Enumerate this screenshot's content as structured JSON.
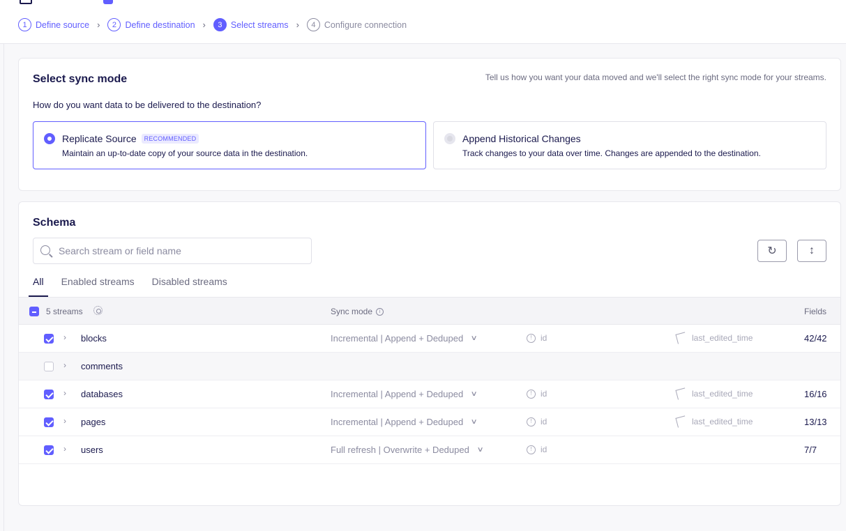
{
  "steps": [
    {
      "num": "1",
      "label": "Define source"
    },
    {
      "num": "2",
      "label": "Define destination"
    },
    {
      "num": "3",
      "label": "Select streams"
    },
    {
      "num": "4",
      "label": "Configure connection"
    }
  ],
  "sync_mode": {
    "title": "Select sync mode",
    "hint": "Tell us how you want your data moved and we'll select the right sync mode for your streams.",
    "question": "How do you want data to be delivered to the destination?",
    "options": [
      {
        "title": "Replicate Source",
        "badge": "RECOMMENDED",
        "description": "Maintain an up-to-date copy of your source data in the destination.",
        "selected": true
      },
      {
        "title": "Append Historical Changes",
        "description": "Track changes to your data over time. Changes are appended to the destination.",
        "selected": false
      }
    ]
  },
  "schema": {
    "title": "Schema",
    "search_placeholder": "Search stream or field name",
    "tabs": [
      "All",
      "Enabled streams",
      "Disabled streams"
    ],
    "header": {
      "count": "5 streams",
      "sync_mode": "Sync mode",
      "fields": "Fields"
    },
    "rows": [
      {
        "name": "blocks",
        "enabled": true,
        "mode": "Incremental | Append + Deduped",
        "pk": "id",
        "cursor": "last_edited_time",
        "fields": "42/42"
      },
      {
        "name": "comments",
        "enabled": false,
        "mode": "",
        "pk": "",
        "cursor": "",
        "fields": ""
      },
      {
        "name": "databases",
        "enabled": true,
        "mode": "Incremental | Append + Deduped",
        "pk": "id",
        "cursor": "last_edited_time",
        "fields": "16/16"
      },
      {
        "name": "pages",
        "enabled": true,
        "mode": "Incremental | Append + Deduped",
        "pk": "id",
        "cursor": "last_edited_time",
        "fields": "13/13"
      },
      {
        "name": "users",
        "enabled": true,
        "mode": "Full refresh | Overwrite + Deduped",
        "pk": "id",
        "cursor": "",
        "fields": "7/7"
      }
    ]
  },
  "colors": {
    "accent": "#615eff",
    "text": "#1a194d",
    "muted": "#8b8ba0"
  }
}
